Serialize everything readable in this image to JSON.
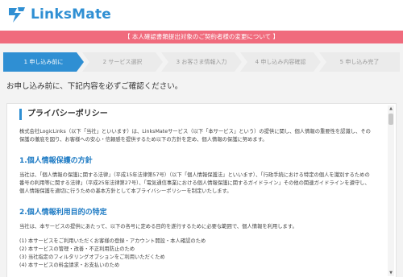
{
  "header": {
    "logo_text": "LinksMate"
  },
  "alert": {
    "text": "【 本人確認書類提出対象のご契約者様の変更について 】"
  },
  "steps": [
    {
      "label": "1 申し込み前に",
      "state": "active"
    },
    {
      "label": "2 サービス選択",
      "state": "inactive"
    },
    {
      "label": "3 お客さま情報入力",
      "state": "inactive"
    },
    {
      "label": "4 申し込み内容確認",
      "state": "inactive"
    },
    {
      "label": "5 申し込み完了",
      "state": "inactive"
    }
  ],
  "intro": "お申し込み前に、下記内容を必ずご確認ください。",
  "policy": {
    "title": "プライバシーポリシー",
    "lead": "株式会社LogicLinks（以下「当社」といいます）は、LinksMateサービス（以下「本サービス」という）の提供に関し、個人情報の重要性を認識し、その保護の徹底を図り、お客様への安心・信頼感を提供するため以下の方針を定め、個人情報の保護に努めます。",
    "section1_title": "1.個人情報保護の方針",
    "section1_body": "当社は、「個人情報の保護に関する法律」（平成15年法律第57号）（以下「個人情報保護法」といいます）、「行政手続における特定の個人を識別するための番号の利用等に関する法律」（平成25年法律第27号）、「電気通信事業における個人情報保護に関するガイドライン」その他の関連ガイドラインを遵守し、個人情報保護を適切に行うための基本方針として本プライバシーポリシーを制定いたします。",
    "section2_title": "2.個人情報利用目的の特定",
    "section2_body": "当社は、本サービスの提供にあたって、以下の各号に定める目的を遂行するために必要な範囲で、個人情報を利用します。",
    "items": [
      "(1) 本サービスをご利用いただくお客様の登録・アカウント開設・本人確認のため",
      "(2) 本サービスの管理・改善・不正利用防止のため",
      "(3) 当社指定のフィルタリングオプションをご利用いただくため",
      "(4) 本サービスの料金請求・お支払いのため"
    ]
  },
  "scrollbar": {
    "up": "▲",
    "down": "▼"
  },
  "colors": {
    "brand": "#2f8fd3",
    "alert": "#f06b7d",
    "step_active": "#2f8fd3",
    "step_inactive": "#ebebeb"
  }
}
